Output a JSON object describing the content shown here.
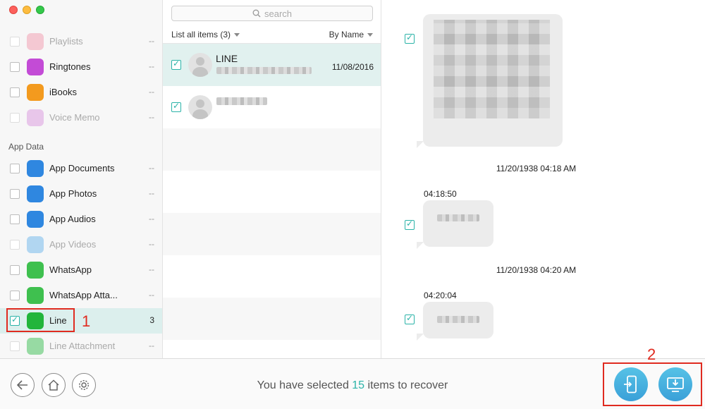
{
  "window": {
    "traffic_lights": [
      "close",
      "minimize",
      "maximize"
    ]
  },
  "sidebar": {
    "items_top": [
      {
        "label": "Playlists",
        "count": "--",
        "icon": "playlist-icon",
        "color": "#f08fa3",
        "dim": true
      },
      {
        "label": "Ringtones",
        "count": "--",
        "icon": "bell-icon",
        "color": "#c34bd6",
        "dim": false
      },
      {
        "label": "iBooks",
        "count": "--",
        "icon": "book-icon",
        "color": "#f39a1e",
        "dim": false
      },
      {
        "label": "Voice Memo",
        "count": "--",
        "icon": "microphone-icon",
        "color": "#d58ad9",
        "dim": true
      }
    ],
    "section_label": "App Data",
    "items_app": [
      {
        "label": "App Documents",
        "count": "--",
        "icon": "document-icon",
        "color": "#2f87e0",
        "dim": false
      },
      {
        "label": "App Photos",
        "count": "--",
        "icon": "photo-icon",
        "color": "#2f87e0",
        "dim": false
      },
      {
        "label": "App Audios",
        "count": "--",
        "icon": "speaker-icon",
        "color": "#2f87e0",
        "dim": false
      },
      {
        "label": "App Videos",
        "count": "--",
        "icon": "video-icon",
        "color": "#5aaee8",
        "dim": true
      },
      {
        "label": "WhatsApp",
        "count": "--",
        "icon": "whatsapp-icon",
        "color": "#3fc04f",
        "dim": false
      },
      {
        "label": "WhatsApp Atta...",
        "count": "--",
        "icon": "whatsapp-attachment-icon",
        "color": "#3fc04f",
        "dim": false
      },
      {
        "label": "Line",
        "count": "3",
        "icon": "line-icon",
        "color": "#22b53b",
        "dim": false,
        "selected": true
      },
      {
        "label": "Line Attachment",
        "count": "--",
        "icon": "line-attachment-icon",
        "color": "#22b53b",
        "dim": true
      }
    ],
    "annotation_1": "1"
  },
  "list": {
    "search_placeholder": "search",
    "header_left": "List all items (3)",
    "header_right": "By Name",
    "rows": [
      {
        "name": "LINE",
        "date": "11/08/2016"
      }
    ]
  },
  "detail": {
    "timestamp_1": "11/20/1938 04:18 AM",
    "time_1": "04:18:50",
    "timestamp_2": "11/20/1938 04:20 AM",
    "time_2": "04:20:04"
  },
  "bottom": {
    "status_prefix": "You have selected ",
    "status_count": "15",
    "status_suffix": " items to recover",
    "annotation_2": "2"
  },
  "colors": {
    "accent": "#2bb3a8",
    "annotation": "#e02b20",
    "button_blue": "#3aa0d8"
  }
}
